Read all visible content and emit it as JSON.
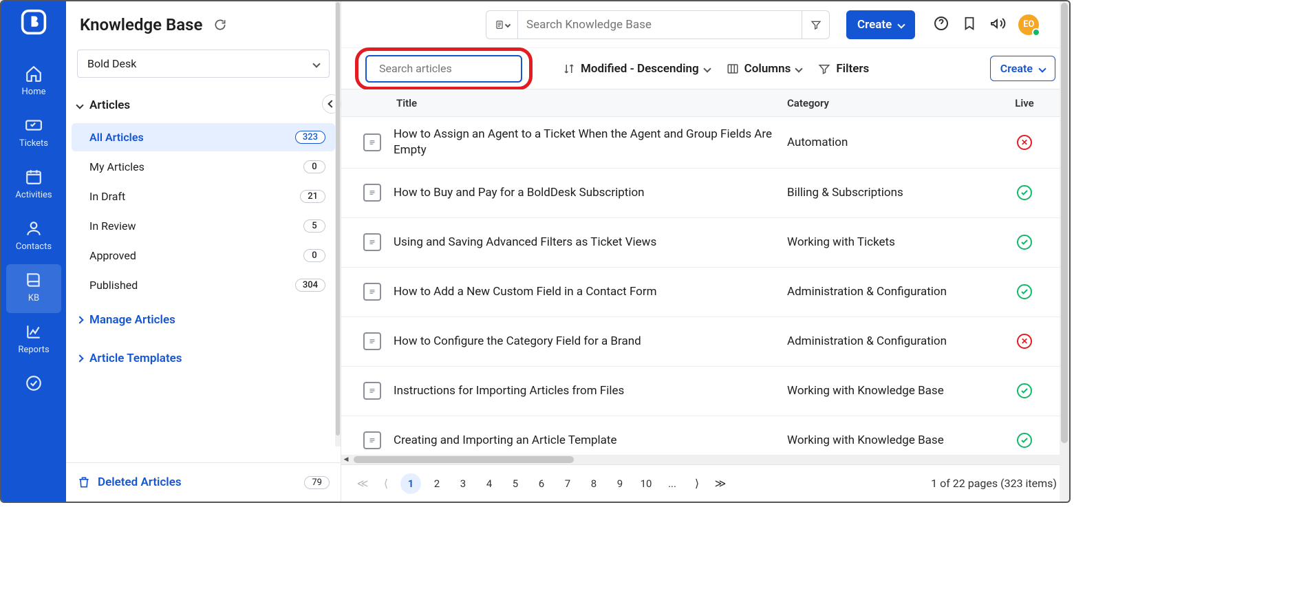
{
  "page_title": "Knowledge Base",
  "brand_selector": "Bold Desk",
  "nav": {
    "items": [
      {
        "label": "Home"
      },
      {
        "label": "Tickets"
      },
      {
        "label": "Activities"
      },
      {
        "label": "Contacts"
      },
      {
        "label": "KB"
      },
      {
        "label": "Reports"
      }
    ]
  },
  "sidebar": {
    "section_label": "Articles",
    "categories": [
      {
        "label": "All Articles",
        "count": "323"
      },
      {
        "label": "My Articles",
        "count": "0"
      },
      {
        "label": "In Draft",
        "count": "21"
      },
      {
        "label": "In Review",
        "count": "5"
      },
      {
        "label": "Approved",
        "count": "0"
      },
      {
        "label": "Published",
        "count": "304"
      }
    ],
    "manage_link": "Manage Articles",
    "templates_link": "Article Templates",
    "deleted_label": "Deleted Articles",
    "deleted_count": "79"
  },
  "topbar": {
    "global_search_placeholder": "Search Knowledge Base",
    "create_label": "Create",
    "avatar_initials": "EO"
  },
  "toolbar": {
    "article_search_placeholder": "Search articles",
    "sort_label": "Modified - Descending",
    "columns_label": "Columns",
    "filters_label": "Filters",
    "create_label": "Create"
  },
  "grid": {
    "headers": {
      "title": "Title",
      "category": "Category",
      "live": "Live"
    },
    "rows": [
      {
        "title": "How to Assign an Agent to a Ticket When the Agent and Group Fields Are Empty",
        "category": "Automation",
        "live": false
      },
      {
        "title": "How to Buy and Pay for a BoldDesk Subscription",
        "category": "Billing & Subscriptions",
        "live": true
      },
      {
        "title": "Using and Saving Advanced Filters as Ticket Views",
        "category": "Working with Tickets",
        "live": true
      },
      {
        "title": "How to Add a New Custom Field in a Contact Form",
        "category": "Administration & Configuration",
        "live": true
      },
      {
        "title": "How to Configure the Category Field for a Brand",
        "category": "Administration & Configuration",
        "live": false
      },
      {
        "title": "Instructions for Importing Articles from Files",
        "category": "Working with Knowledge Base",
        "live": true
      },
      {
        "title": "Creating and Importing an Article Template",
        "category": "Working with Knowledge Base",
        "live": true
      }
    ]
  },
  "pager": {
    "pages": [
      "1",
      "2",
      "3",
      "4",
      "5",
      "6",
      "7",
      "8",
      "9",
      "10",
      "..."
    ],
    "info": "1 of 22 pages (323 items)"
  }
}
